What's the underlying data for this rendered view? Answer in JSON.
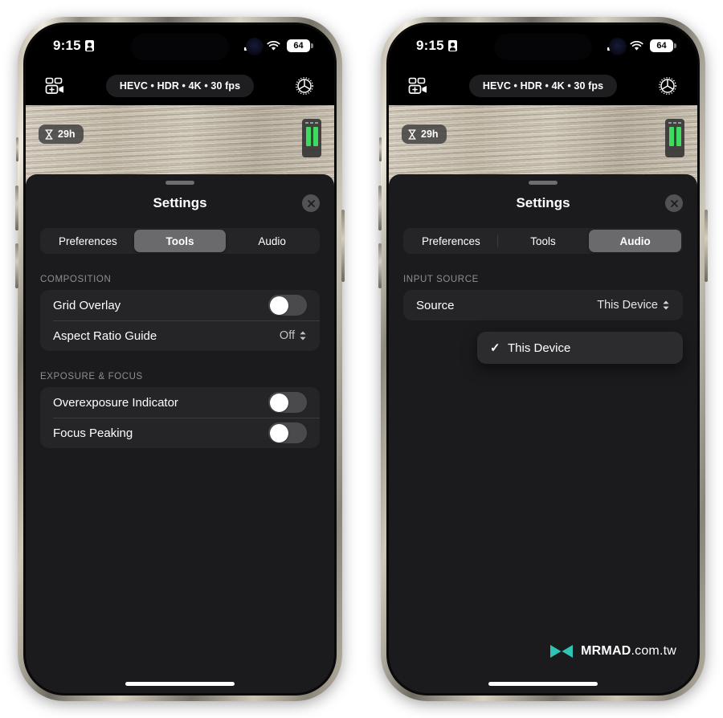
{
  "background_color": "#ffffff",
  "phones": [
    {
      "id": "left",
      "status_bar": {
        "time": "9:15",
        "lock_icon": "portrait-lock-icon",
        "signal_icon": "cellular-signal-icon",
        "wifi_icon": "wifi-icon",
        "battery_level": "64"
      },
      "app_bar": {
        "left_icon": "multicam-add-video-icon",
        "format_pill": "HEVC • HDR • 4K • 30 fps",
        "right_icon": "gear-aperture-icon"
      },
      "preview": {
        "time_badge": "29h",
        "time_badge_icon": "hourglass-icon",
        "level_meter_icon": "audio-level-meter-icon"
      },
      "sheet": {
        "title": "Settings",
        "close_icon": "close-icon",
        "tabs": [
          {
            "label": "Preferences",
            "active": false
          },
          {
            "label": "Tools",
            "active": true
          },
          {
            "label": "Audio",
            "active": false
          }
        ],
        "sections": [
          {
            "header": "COMPOSITION",
            "rows": [
              {
                "label": "Grid Overlay",
                "control": "toggle",
                "value": "off"
              },
              {
                "label": "Aspect Ratio Guide",
                "control": "picker",
                "value": "Off"
              }
            ]
          },
          {
            "header": "EXPOSURE & FOCUS",
            "rows": [
              {
                "label": "Overexposure Indicator",
                "control": "toggle",
                "value": "off"
              },
              {
                "label": "Focus Peaking",
                "control": "toggle",
                "value": "off"
              }
            ]
          }
        ]
      },
      "watermark": null
    },
    {
      "id": "right",
      "status_bar": {
        "time": "9:15",
        "lock_icon": "portrait-lock-icon",
        "signal_icon": "cellular-signal-icon",
        "wifi_icon": "wifi-icon",
        "battery_level": "64"
      },
      "app_bar": {
        "left_icon": "multicam-add-video-icon",
        "format_pill": "HEVC • HDR • 4K • 30 fps",
        "right_icon": "gear-aperture-icon"
      },
      "preview": {
        "time_badge": "29h",
        "time_badge_icon": "hourglass-icon",
        "level_meter_icon": "audio-level-meter-icon"
      },
      "sheet": {
        "title": "Settings",
        "close_icon": "close-icon",
        "tabs": [
          {
            "label": "Preferences",
            "active": false
          },
          {
            "label": "Tools",
            "active": false
          },
          {
            "label": "Audio",
            "active": true
          }
        ],
        "sections": [
          {
            "header": "INPUT SOURCE",
            "rows": [
              {
                "label": "Source",
                "control": "picker",
                "value": "This Device"
              }
            ]
          }
        ],
        "popup": {
          "items": [
            {
              "label": "This Device",
              "checked": true,
              "check_icon": "checkmark-icon"
            }
          ]
        }
      },
      "watermark": {
        "logo_icon": "mrmad-logo-icon",
        "brand": "MRMAD",
        "suffix": ".com.tw",
        "color": "#2ec4b6"
      }
    }
  ]
}
